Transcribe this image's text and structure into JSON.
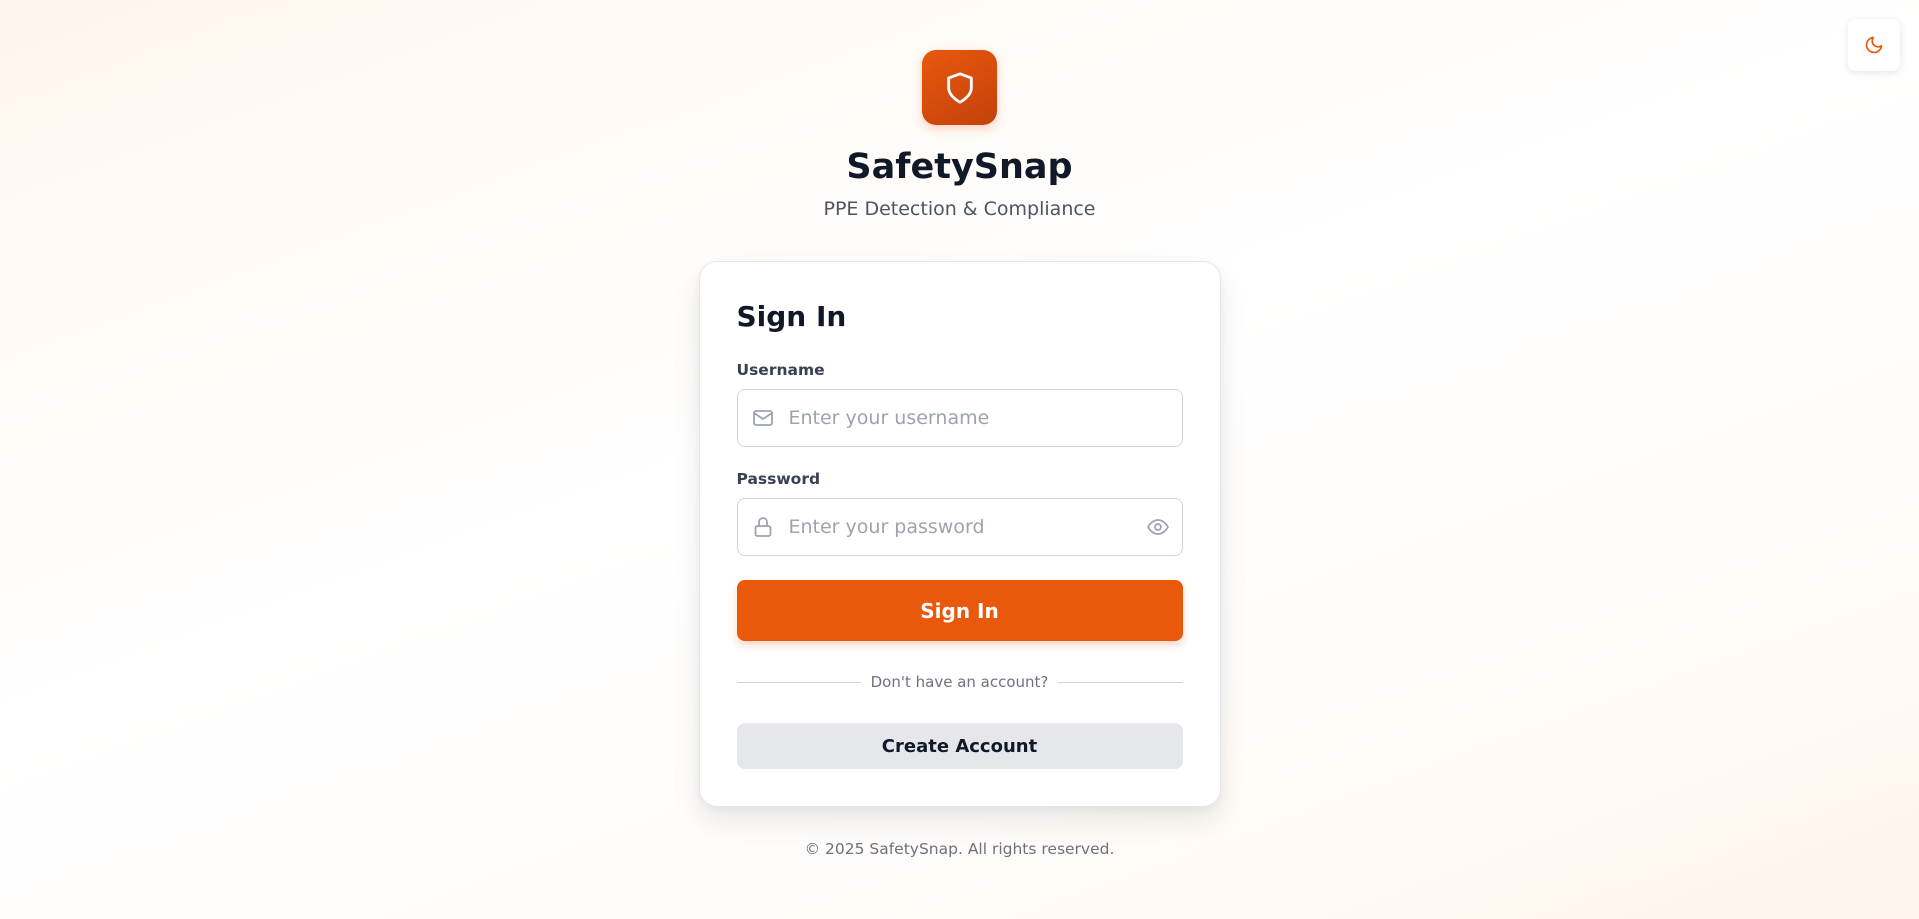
{
  "header": {
    "theme_toggle_icon": "moon-icon"
  },
  "brand": {
    "logo_icon": "shield-icon",
    "title": "SafetySnap",
    "subtitle": "PPE Detection & Compliance",
    "accent_color": "#ea580c"
  },
  "login_form": {
    "title": "Sign In",
    "username": {
      "label": "Username",
      "placeholder": "Enter your username",
      "value": "",
      "icon": "mail-icon"
    },
    "password": {
      "label": "Password",
      "placeholder": "Enter your password",
      "value": "",
      "icon": "lock-icon",
      "toggle_icon": "eye-icon"
    },
    "submit_label": "Sign In",
    "divider_text": "Don't have an account?",
    "create_account_label": "Create Account"
  },
  "footer": {
    "copyright": "© 2025 SafetySnap. All rights reserved."
  }
}
